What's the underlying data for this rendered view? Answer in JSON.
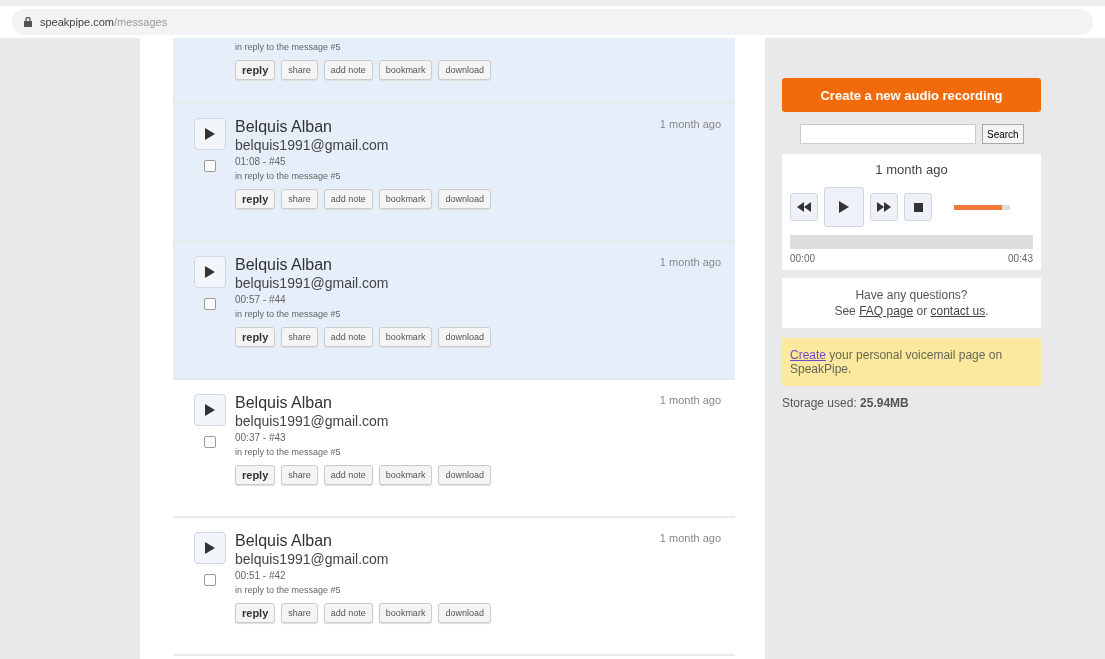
{
  "address_bar": {
    "domain": "speakpipe.com",
    "path": "/messages"
  },
  "messages": [
    {
      "kind": "partial",
      "highlighted": true,
      "reply_to": "in reply to the message #5",
      "buttons": [
        "reply",
        "share",
        "add note",
        "bookmark",
        "download"
      ]
    },
    {
      "kind": "full",
      "highlighted": true,
      "name": "Belquis Alban",
      "email": "belquis1991@gmail.com",
      "meta": "01:08 - #45",
      "reply_to": "in reply to the message #5",
      "time": "1 month ago",
      "checked": false,
      "buttons": [
        "reply",
        "share",
        "add note",
        "bookmark",
        "download"
      ]
    },
    {
      "kind": "full",
      "highlighted": true,
      "name": "Belquis Alban",
      "email": "belquis1991@gmail.com",
      "meta": "00:57 - #44",
      "reply_to": "in reply to the message #5",
      "time": "1 month ago",
      "checked": false,
      "buttons": [
        "reply",
        "share",
        "add note",
        "bookmark",
        "download"
      ]
    },
    {
      "kind": "full",
      "highlighted": false,
      "name": "Belquis Alban",
      "email": "belquis1991@gmail.com",
      "meta": "00:37 - #43",
      "reply_to": "in reply to the message #5",
      "time": "1 month ago",
      "checked": false,
      "buttons": [
        "reply",
        "share",
        "add note",
        "bookmark",
        "download"
      ]
    },
    {
      "kind": "full",
      "highlighted": false,
      "name": "Belquis Alban",
      "email": "belquis1991@gmail.com",
      "meta": "00:51 - #42",
      "reply_to": "in reply to the message #5",
      "time": "1 month ago",
      "checked": false,
      "buttons": [
        "reply",
        "share",
        "add note",
        "bookmark",
        "download"
      ]
    }
  ],
  "sidebar": {
    "create_button": "Create a new audio recording",
    "search_button": "Search",
    "player": {
      "time": "1 month ago",
      "volume": {
        "level": 0.85
      },
      "start": "00:00",
      "end": "00:43"
    },
    "help": {
      "question": "Have any questions?",
      "see": "See",
      "faq_link": "FAQ page",
      "or": "or",
      "contact_link": "contact us",
      "end": "."
    },
    "promo": {
      "link": "Create",
      "text": "your personal voicemail page on SpeakPipe."
    },
    "storage": "Storage used: **25.94MB**"
  }
}
